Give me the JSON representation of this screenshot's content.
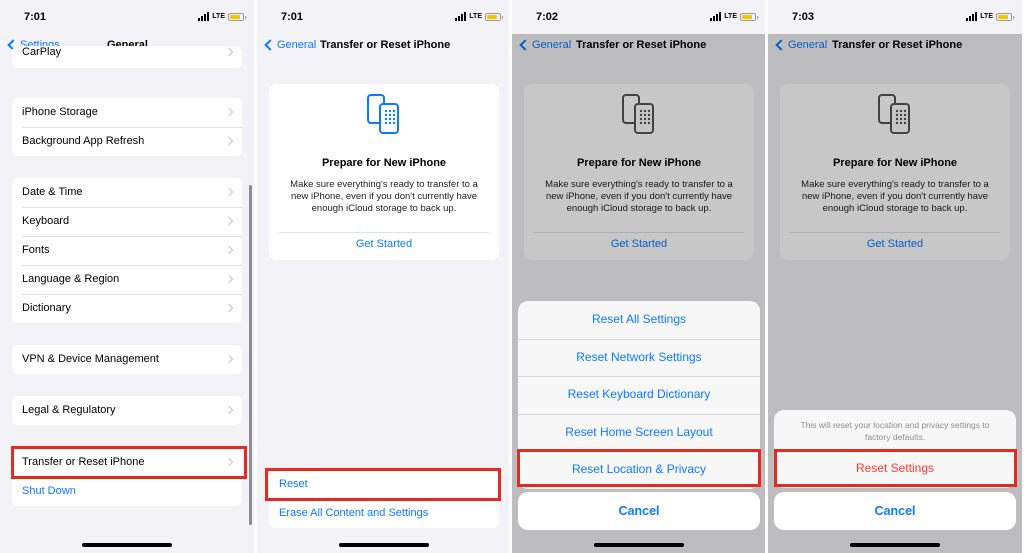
{
  "colors": {
    "accent": "#0a7aff",
    "highlight": "#e32b20",
    "destructive": "#ff3b30"
  },
  "status_bar": {
    "network": "LTE"
  },
  "panel1": {
    "time": "7:01",
    "back_label": "Settings",
    "title": "General",
    "partial_row": "CarPlay",
    "group_storage": [
      "iPhone Storage",
      "Background App Refresh"
    ],
    "group_datetime": [
      "Date & Time",
      "Keyboard",
      "Fonts",
      "Language & Region",
      "Dictionary"
    ],
    "vpn": "VPN & Device Management",
    "legal": "Legal & Regulatory",
    "transfer": "Transfer or Reset iPhone",
    "shutdown": "Shut Down"
  },
  "panel2": {
    "time": "7:01",
    "back_label": "General",
    "title": "Transfer or Reset iPhone",
    "card_title": "Prepare for New iPhone",
    "card_body": "Make sure everything's ready to transfer to a new iPhone, even if you don't currently have enough iCloud storage to back up.",
    "card_link": "Get Started",
    "reset": "Reset",
    "erase": "Erase All Content and Settings"
  },
  "panel3": {
    "time": "7:02",
    "back_label": "General",
    "title": "Transfer or Reset iPhone",
    "card_title": "Prepare for New iPhone",
    "card_body": "Make sure everything's ready to transfer to a new iPhone, even if you don't currently have enough iCloud storage to back up.",
    "card_link": "Get Started",
    "options": [
      "Reset All Settings",
      "Reset Network Settings",
      "Reset Keyboard Dictionary",
      "Reset Home Screen Layout",
      "Reset Location & Privacy"
    ],
    "cancel": "Cancel"
  },
  "panel4": {
    "time": "7:03",
    "back_label": "General",
    "title": "Transfer or Reset iPhone",
    "card_title": "Prepare for New iPhone",
    "card_body": "Make sure everything's ready to transfer to a new iPhone, even if you don't currently have enough iCloud storage to back up.",
    "card_link": "Get Started",
    "note": "This will reset your location and privacy settings to factory defaults.",
    "confirm": "Reset Settings",
    "cancel": "Cancel"
  }
}
